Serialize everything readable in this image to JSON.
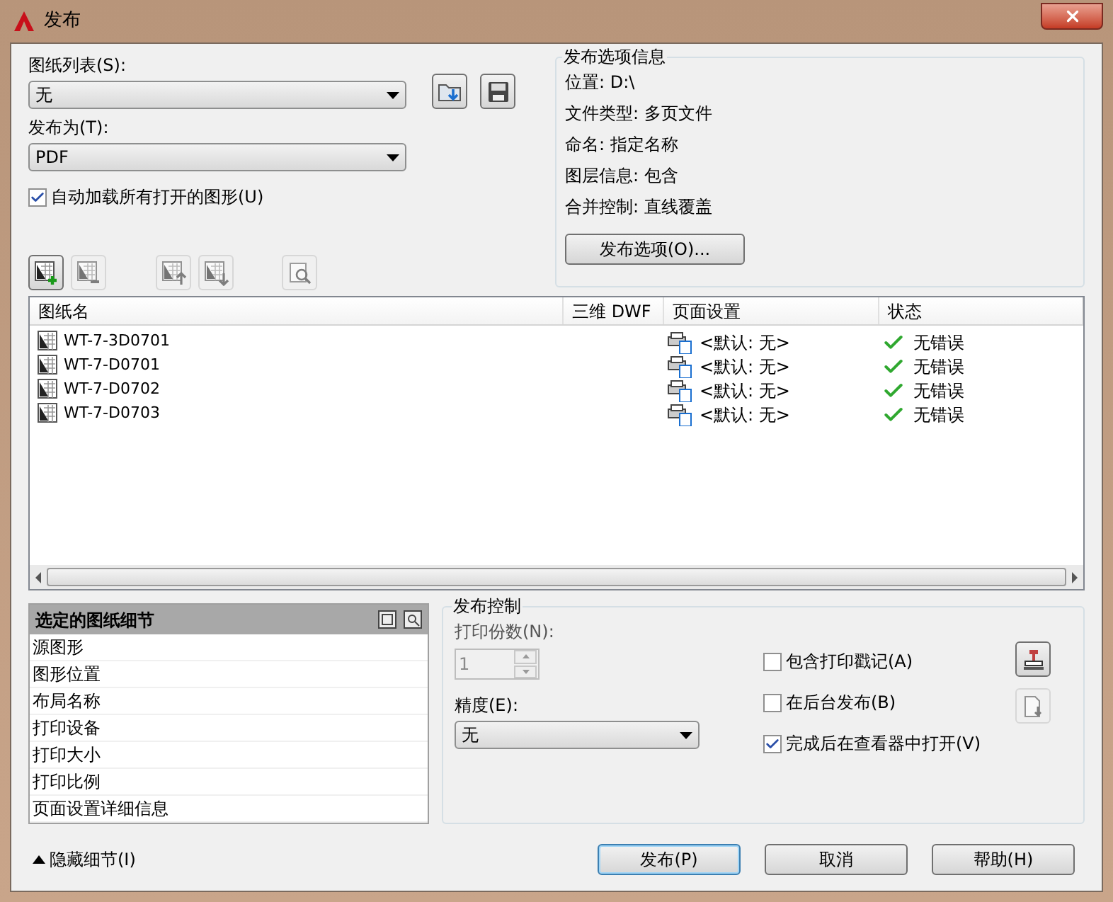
{
  "window": {
    "title": "发布"
  },
  "sheet_list": {
    "label": "图纸列表(S):",
    "value": "无"
  },
  "publish_to": {
    "label": "发布为(T):",
    "value": "PDF"
  },
  "auto_load": {
    "label": "自动加载所有打开的图形(U)",
    "checked": true
  },
  "options_info": {
    "title": "发布选项信息",
    "lines": [
      "位置: D:\\",
      "文件类型: 多页文件",
      "命名: 指定名称",
      "图层信息: 包含",
      "合并控制: 直线覆盖"
    ],
    "button": "发布选项(O)..."
  },
  "table": {
    "columns": [
      "图纸名",
      "三维 DWF",
      "页面设置",
      "状态"
    ],
    "rows": [
      {
        "name": "WT-7-3D0701",
        "page_setup": "<默认: 无>",
        "status": "无错误"
      },
      {
        "name": "WT-7-D0701",
        "page_setup": "<默认: 无>",
        "status": "无错误"
      },
      {
        "name": "WT-7-D0702",
        "page_setup": "<默认: 无>",
        "status": "无错误"
      },
      {
        "name": "WT-7-D0703",
        "page_setup": "<默认: 无>",
        "status": "无错误"
      }
    ]
  },
  "details": {
    "title": "选定的图纸细节",
    "items": [
      "源图形",
      "图形位置",
      "布局名称",
      "打印设备",
      "打印大小",
      "打印比例",
      "页面设置详细信息"
    ]
  },
  "publish_control": {
    "title": "发布控制",
    "copies_label": "打印份数(N):",
    "copies": "1",
    "copies_disabled": true,
    "precision_label": "精度(E):",
    "precision": "无",
    "options": [
      {
        "label": "包含打印戳记(A)",
        "checked": false
      },
      {
        "label": "在后台发布(B)",
        "checked": false
      },
      {
        "label": "完成后在查看器中打开(V)",
        "checked": true
      }
    ]
  },
  "hide_details": "隐藏细节(I)",
  "buttons": [
    {
      "label": "发布(P)",
      "default": true
    },
    {
      "label": "取消",
      "default": false
    },
    {
      "label": "帮助(H)",
      "default": false
    }
  ]
}
